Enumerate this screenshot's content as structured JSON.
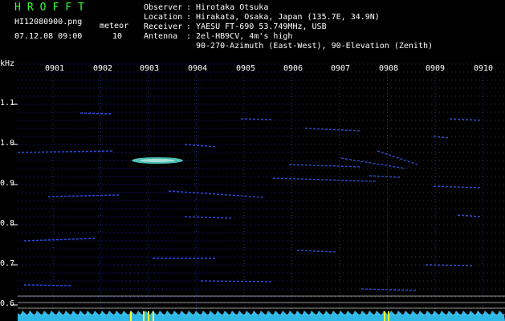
{
  "header": {
    "logo": "HROFFT",
    "filename": "HI12080900.png",
    "datetime": "07.12.08 09:00",
    "counter_label": "meteor",
    "counter_value": "10"
  },
  "info": {
    "observer_label": "Observer",
    "observer_value": ": Hirotaka Otsuka",
    "location_label": "Location",
    "location_value": ": Hirakata, Osaka, Japan (135.7E, 34.9N)",
    "receiver_label": "Receiver",
    "receiver_value": ": YAESU FT-690 53.749MHz, USB",
    "antenna_label": "Antenna",
    "antenna_value": ": 2el-HB9CV, 4m's high",
    "antenna_value_2": "90-270-Azimuth (East-West), 90-Elevation (Zenith)"
  },
  "axis": {
    "y_unit": "kHz",
    "y_ticks": [
      "1.1",
      "1.0",
      "0.9",
      "0.8",
      "0.7",
      "0.6"
    ],
    "x_ticks": [
      "0901",
      "0902",
      "0903",
      "0904",
      "0905",
      "0906",
      "0907",
      "0908",
      "0909",
      "0910"
    ]
  },
  "colors": {
    "background": "#000000",
    "logo": "#33ff33",
    "text": "#ffffff",
    "grid": "#2a2a8a",
    "signal": "#3a5cff",
    "meteor": "#66ffee",
    "baseline": "#33ccff",
    "marker": "#ffff33"
  }
}
